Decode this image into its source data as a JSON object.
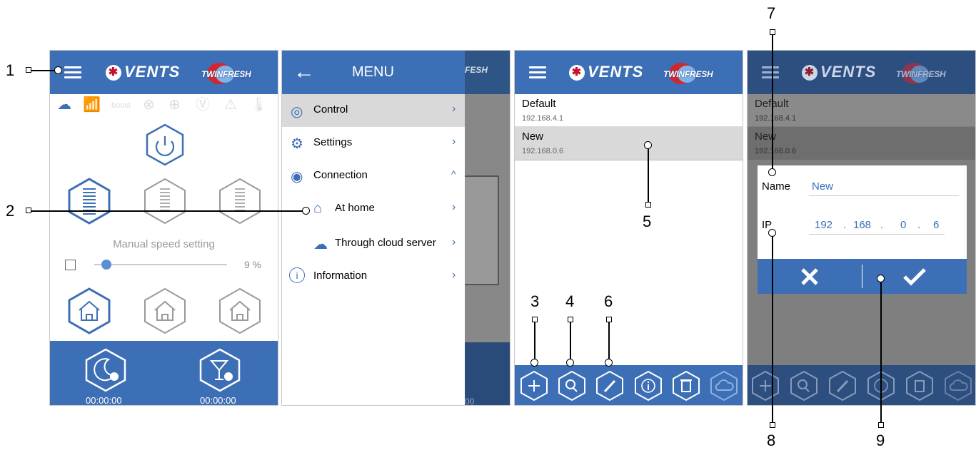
{
  "callouts": [
    "1",
    "2",
    "3",
    "4",
    "5",
    "6",
    "7",
    "8",
    "9"
  ],
  "brand": {
    "vents": "VENTS",
    "twinfresh": "TWINFRESH"
  },
  "screen1": {
    "status_boost": "boost",
    "manual_speed_label": "Manual speed setting",
    "speed_percent": "9 %",
    "speed_value": 0.09,
    "timer_left": "00:00:00",
    "timer_right": "00:00:00"
  },
  "screen2": {
    "menu_title": "MENU",
    "items": [
      {
        "label": "Control",
        "icon": "control-icon"
      },
      {
        "label": "Settings",
        "icon": "settings-icon"
      },
      {
        "label": "Connection",
        "icon": "wifi-icon"
      },
      {
        "label": "At home",
        "icon": "home-icon"
      },
      {
        "label": "Through cloud server",
        "icon": "cloud-icon"
      },
      {
        "label": "Information",
        "icon": "info-icon"
      }
    ],
    "behind_timer": "00"
  },
  "screen3": {
    "devices": [
      {
        "name": "Default",
        "ip": "192.168.4.1"
      },
      {
        "name": "New",
        "ip": "192.168.0.6"
      }
    ]
  },
  "screen4": {
    "bg_devices": [
      {
        "name": "Default",
        "ip": "192.168.4.1"
      },
      {
        "name": "New",
        "ip": "192.168.0.6"
      }
    ],
    "dialog": {
      "name_label": "Name",
      "name_value": "New",
      "ip_label": "IP",
      "ip_octets": [
        "192",
        "168",
        "0",
        "6"
      ],
      "ip_sep": "."
    }
  },
  "colors": {
    "primary": "#3d6fb6",
    "selected": "#d9d9d9",
    "overlay": "#7f7f7f"
  }
}
